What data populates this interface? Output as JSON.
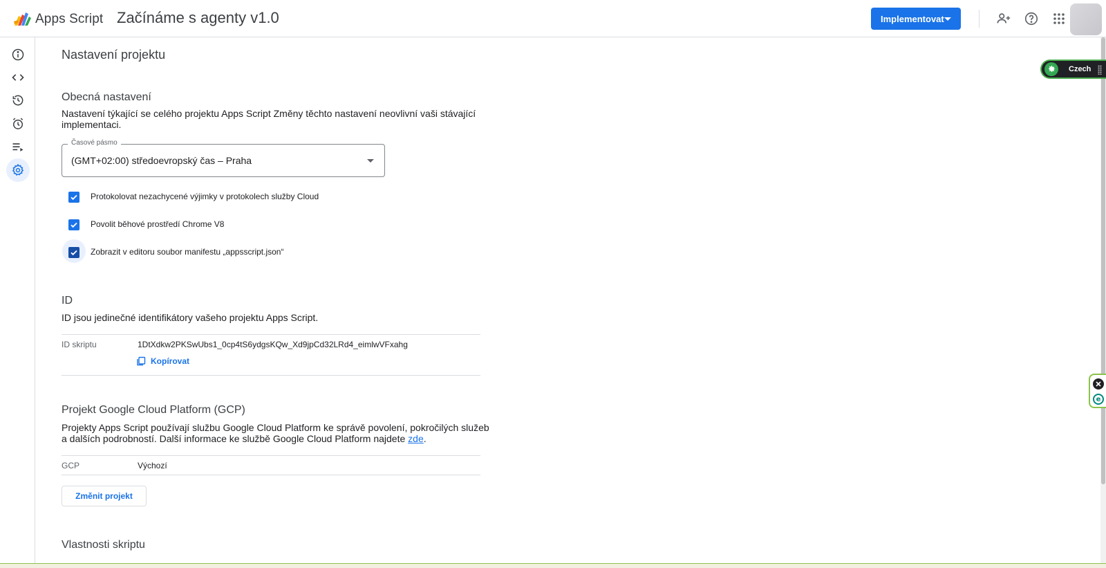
{
  "header": {
    "brand": "Apps Script",
    "project_title": "Začínáme s agenty v1.0",
    "deploy_label": "Implementovat",
    "icons": [
      "add-person-icon",
      "help-icon",
      "apps-grid-icon"
    ]
  },
  "rail": {
    "items": [
      {
        "name": "info-icon",
        "active": false
      },
      {
        "name": "code-icon",
        "active": false
      },
      {
        "name": "history-icon",
        "active": false
      },
      {
        "name": "alarm-icon",
        "active": false
      },
      {
        "name": "executions-icon",
        "active": false
      },
      {
        "name": "settings-gear-icon",
        "active": true
      }
    ]
  },
  "page": {
    "title": "Nastavení projektu"
  },
  "general": {
    "title": "Obecná nastavení",
    "description": "Nastavení týkající se celého projektu Apps Script Změny těchto nastavení neovlivní vaši stávající implementaci.",
    "timezone_label": "Časové pásmo",
    "timezone_value": "(GMT+02:00) středoevropský čas – Praha",
    "checkboxes": [
      {
        "label": "Protokolovat nezachycené výjimky v protokolech služby Cloud",
        "checked": true
      },
      {
        "label": "Povolit běhové prostředí Chrome V8",
        "checked": true
      },
      {
        "label": "Zobrazit v editoru soubor manifestu „appsscript.json“",
        "checked": true
      }
    ]
  },
  "ids": {
    "title": "ID",
    "description": "ID jsou jedinečné identifikátory vašeho projektu Apps Script.",
    "script_id_label": "ID skriptu",
    "script_id_value": "1DtXdkw2PKSwUbs1_0cp4tS6ydgsKQw_Xd9jpCd32LRd4_eimlwVFxahg",
    "copy_label": "Kopírovat"
  },
  "gcp": {
    "title": "Projekt Google Cloud Platform (GCP)",
    "description_before_link": "Projekty Apps Script používají službu Google Cloud Platform ke správě povolení, pokročilých služeb a dalších podrobností. Další informace ke službě Google Cloud Platform najdete ",
    "link_text": "zde",
    "description_after_link": ".",
    "key": "GCP",
    "value": "Výchozí",
    "change_button": "Změnit projekt"
  },
  "properties": {
    "title": "Vlastnosti skriptu"
  },
  "extension": {
    "language_label": "Czech"
  },
  "colors": {
    "accent": "#1a73e8",
    "active_rail_bg": "#e8f0fe",
    "extension_border": "#4caf50"
  }
}
